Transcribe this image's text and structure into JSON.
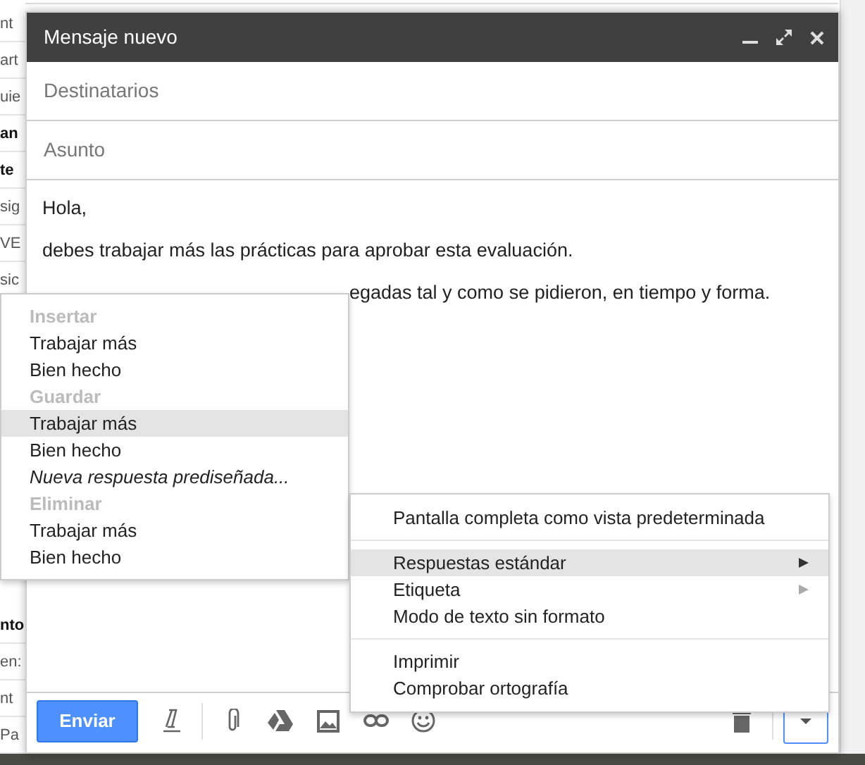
{
  "background_rows_top": [
    {
      "text": "nt",
      "bold": false
    },
    {
      "text": "art",
      "bold": false
    },
    {
      "text": "uie",
      "bold": false
    },
    {
      "text": "an",
      "bold": true
    },
    {
      "text": "te",
      "bold": true
    },
    {
      "text": "sig",
      "bold": false
    },
    {
      "text": "VE",
      "bold": false
    },
    {
      "text": "sic",
      "bold": false
    }
  ],
  "background_rows_bottom": [
    {
      "text": "nto",
      "bold": true
    },
    {
      "text": "en:",
      "bold": false
    },
    {
      "text": "nt",
      "bold": false
    },
    {
      "text": "Pa",
      "bold": false
    }
  ],
  "compose": {
    "title": "Mensaje nuevo",
    "recipients": {
      "placeholder": "Destinatarios"
    },
    "subject": {
      "placeholder": "Asunto"
    },
    "body_lines": [
      "Hola,",
      "debes trabajar más las prácticas para aprobar esta evaluación.",
      "egadas tal y como se pidieron, en tiempo y forma."
    ],
    "send_button": "Enviar",
    "more_selected": true
  },
  "canned_menu": [
    {
      "kind": "heading",
      "label": "Insertar",
      "highlighted": false
    },
    {
      "kind": "item",
      "label": "Trabajar más",
      "highlighted": false
    },
    {
      "kind": "item",
      "label": "Bien hecho",
      "highlighted": false
    },
    {
      "kind": "heading",
      "label": "Guardar",
      "highlighted": false
    },
    {
      "kind": "item",
      "label": "Trabajar más",
      "highlighted": true
    },
    {
      "kind": "item",
      "label": "Bien hecho",
      "highlighted": false
    },
    {
      "kind": "new",
      "label": "Nueva respuesta prediseñada...",
      "highlighted": false
    },
    {
      "kind": "heading",
      "label": "Eliminar",
      "highlighted": false
    },
    {
      "kind": "item",
      "label": "Trabajar más",
      "highlighted": false
    },
    {
      "kind": "item",
      "label": "Bien hecho",
      "highlighted": false
    }
  ],
  "more_menu": [
    {
      "kind": "item",
      "label": "Pantalla completa como vista predeterminada",
      "highlighted": false,
      "submenu": false
    },
    {
      "kind": "separator"
    },
    {
      "kind": "item",
      "label": "Respuestas estándar",
      "highlighted": true,
      "submenu": true
    },
    {
      "kind": "item",
      "label": "Etiqueta",
      "highlighted": false,
      "submenu": true
    },
    {
      "kind": "item",
      "label": "Modo de texto sin formato",
      "highlighted": false,
      "submenu": false
    },
    {
      "kind": "separator"
    },
    {
      "kind": "item",
      "label": "Imprimir",
      "highlighted": false,
      "submenu": false
    },
    {
      "kind": "item",
      "label": "Comprobar ortografía",
      "highlighted": false,
      "submenu": false
    }
  ]
}
